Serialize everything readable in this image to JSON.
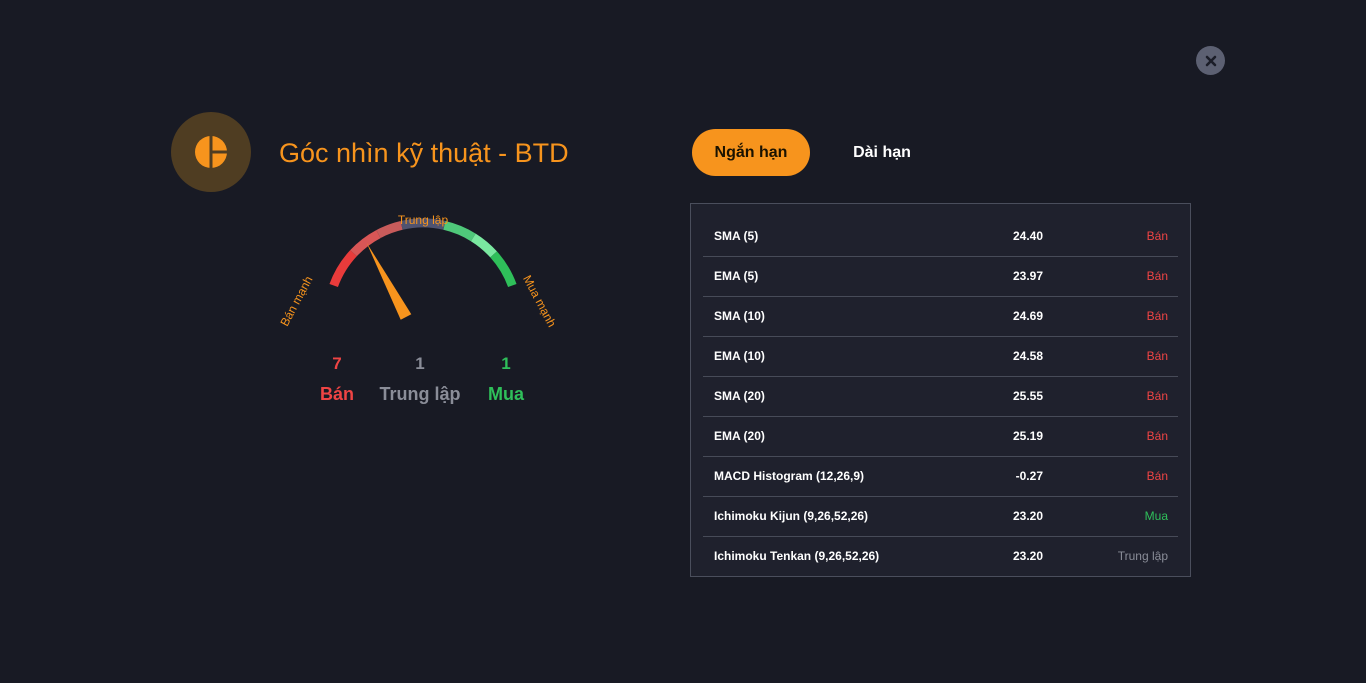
{
  "header": {
    "title": "Góc nhìn kỹ thuật - BTD",
    "logo_icon": "pie-chart-icon",
    "close_icon": "close-icon"
  },
  "gauge": {
    "label_left": "Bán mạnh",
    "label_top": "Trung lập",
    "label_right": "Mua mạnh",
    "needle_level": 0.3
  },
  "summary": {
    "sell_count": "7",
    "neutral_count": "1",
    "buy_count": "1",
    "sell_label": "Bán",
    "neutral_label": "Trung lập",
    "buy_label": "Mua"
  },
  "tabs": {
    "short": "Ngắn hạn",
    "long": "Dài hạn",
    "active": "short"
  },
  "indicators": [
    {
      "name": "SMA (5)",
      "value": "24.40",
      "signal": "Bán",
      "type": "sell"
    },
    {
      "name": "EMA (5)",
      "value": "23.97",
      "signal": "Bán",
      "type": "sell"
    },
    {
      "name": "SMA (10)",
      "value": "24.69",
      "signal": "Bán",
      "type": "sell"
    },
    {
      "name": "EMA (10)",
      "value": "24.58",
      "signal": "Bán",
      "type": "sell"
    },
    {
      "name": "SMA (20)",
      "value": "25.55",
      "signal": "Bán",
      "type": "sell"
    },
    {
      "name": "EMA (20)",
      "value": "25.19",
      "signal": "Bán",
      "type": "sell"
    },
    {
      "name": "MACD Histogram (12,26,9)",
      "value": "-0.27",
      "signal": "Bán",
      "type": "sell"
    },
    {
      "name": "Ichimoku Kijun (9,26,52,26)",
      "value": "23.20",
      "signal": "Mua",
      "type": "buy"
    },
    {
      "name": "Ichimoku Tenkan (9,26,52,26)",
      "value": "23.20",
      "signal": "Trung lập",
      "type": "neutral"
    }
  ],
  "colors": {
    "accent": "#f7941d",
    "sell": "#ef4444",
    "buy": "#2fbf5a",
    "neutral": "#8a8d98",
    "background": "#181a24"
  }
}
